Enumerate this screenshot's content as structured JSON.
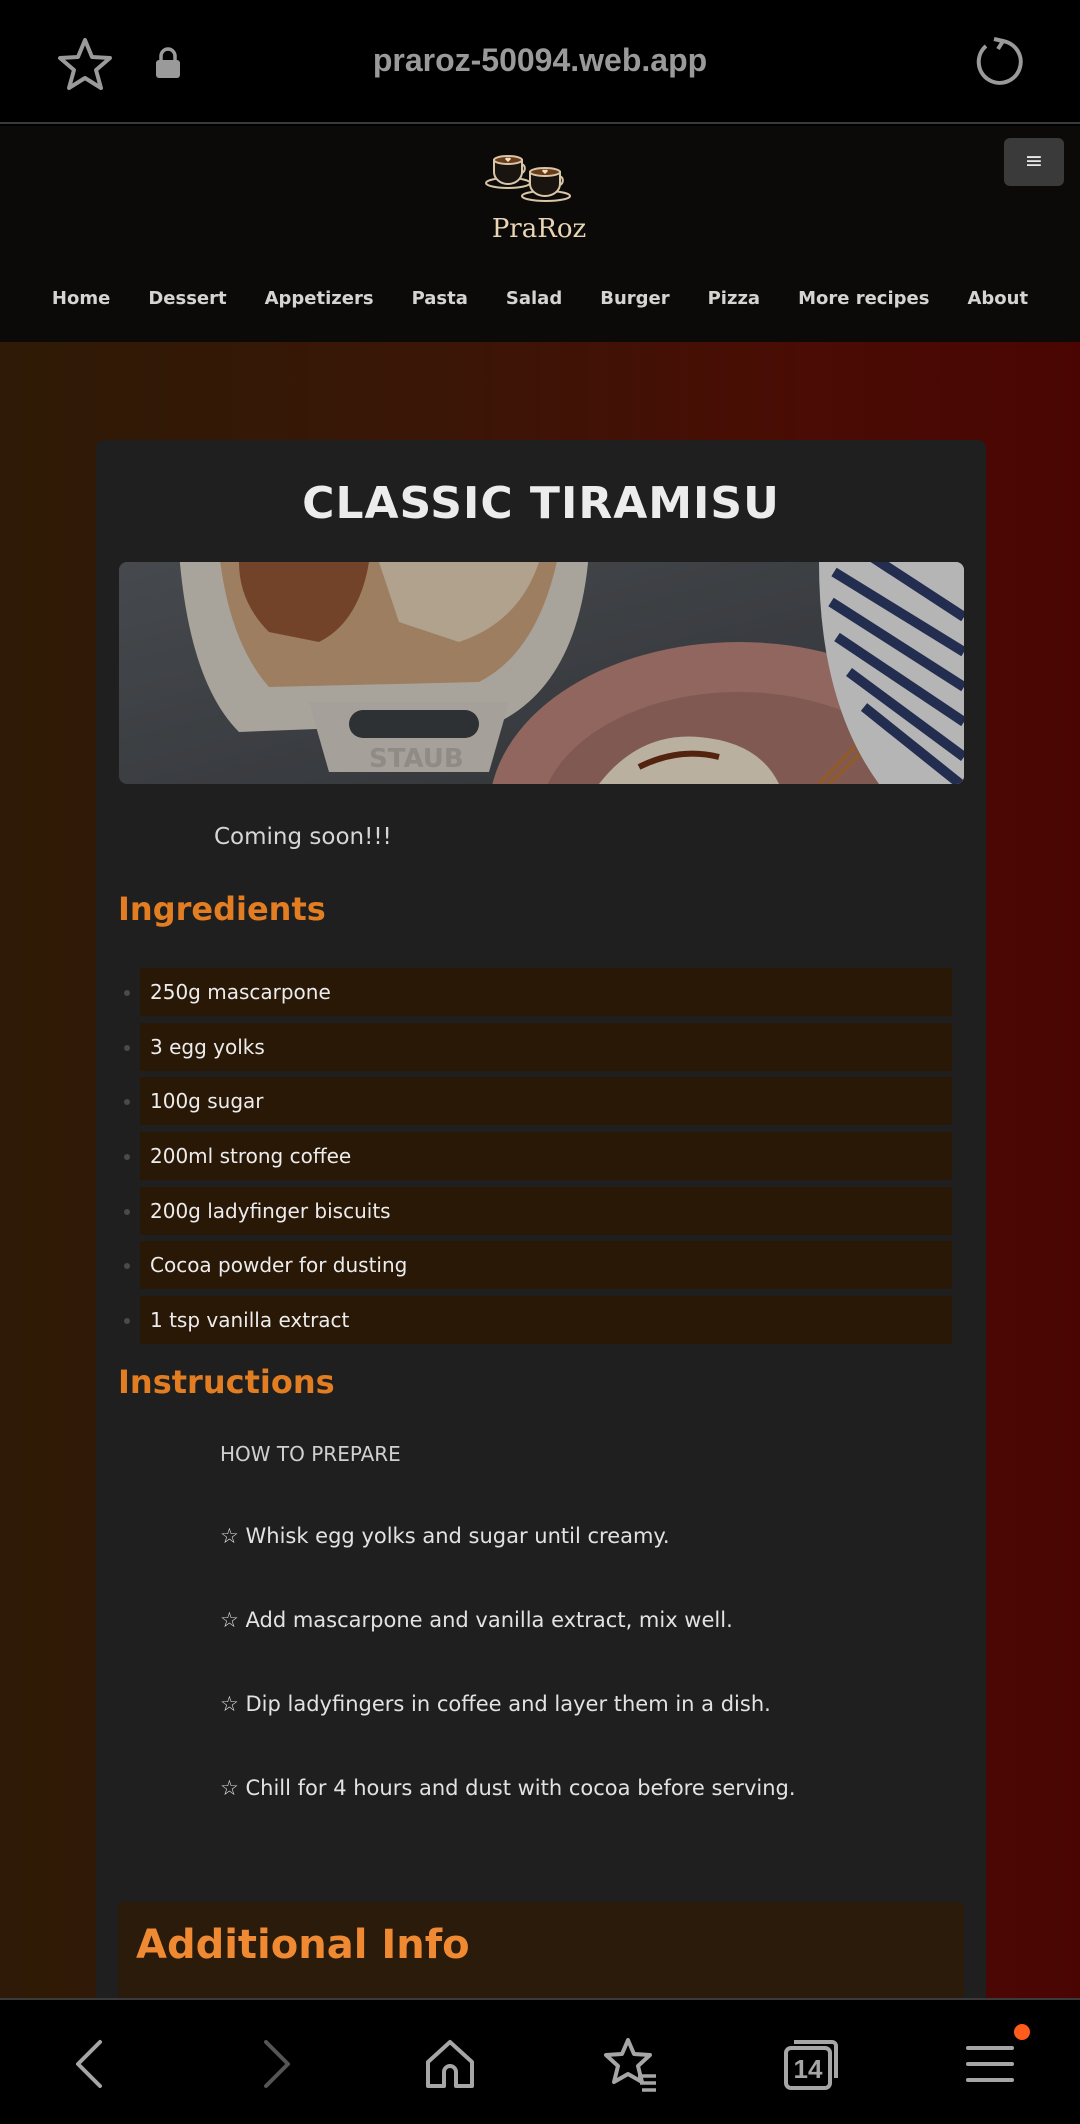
{
  "browser": {
    "url": "praroz-50094.web.app",
    "tab_count": "14"
  },
  "site": {
    "logo_text": "PraRoz",
    "menu_toggle": "≡",
    "nav": [
      "Home",
      "Dessert",
      "Appetizers",
      "Pasta",
      "Salad",
      "Burger",
      "Pizza",
      "More recipes",
      "About"
    ]
  },
  "recipe": {
    "title": "CLASSIC TIRAMISU",
    "coming_soon": "Coming soon!!!",
    "ingredients_heading": "Ingredients",
    "ingredients": [
      "250g mascarpone",
      "3 egg yolks",
      "100g sugar",
      "200ml strong coffee",
      "200g ladyfinger biscuits",
      "Cocoa powder for dusting",
      "1 tsp vanilla extract"
    ],
    "instructions_heading": "Instructions",
    "how_to": "HOW TO PREPARE",
    "steps": [
      "☆ Whisk egg yolks and sugar until creamy.",
      "☆ Add mascarpone and vanilla extract, mix well.",
      "☆ Dip ladyfingers in coffee and layer them in a dish.",
      "☆ Chill for 4 hours and dust with cocoa before serving."
    ],
    "additional_heading": "Additional Info"
  },
  "colors": {
    "accent": "#e27d22",
    "card": "#1f1f1f",
    "ingredient_bg": "#2a1807",
    "notification": "#ff5b1a"
  }
}
